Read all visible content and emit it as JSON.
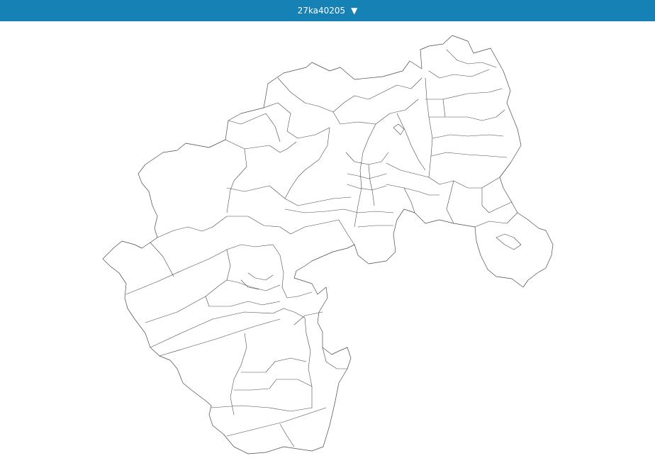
{
  "header": {
    "selector_label": "27ka40205",
    "dropdown_icon": "▼",
    "bar_color": "#1581b5",
    "text_color": "#ffffff"
  },
  "map": {
    "boundary_color": "#4a4a4a",
    "fill_color": "#ffffff"
  }
}
